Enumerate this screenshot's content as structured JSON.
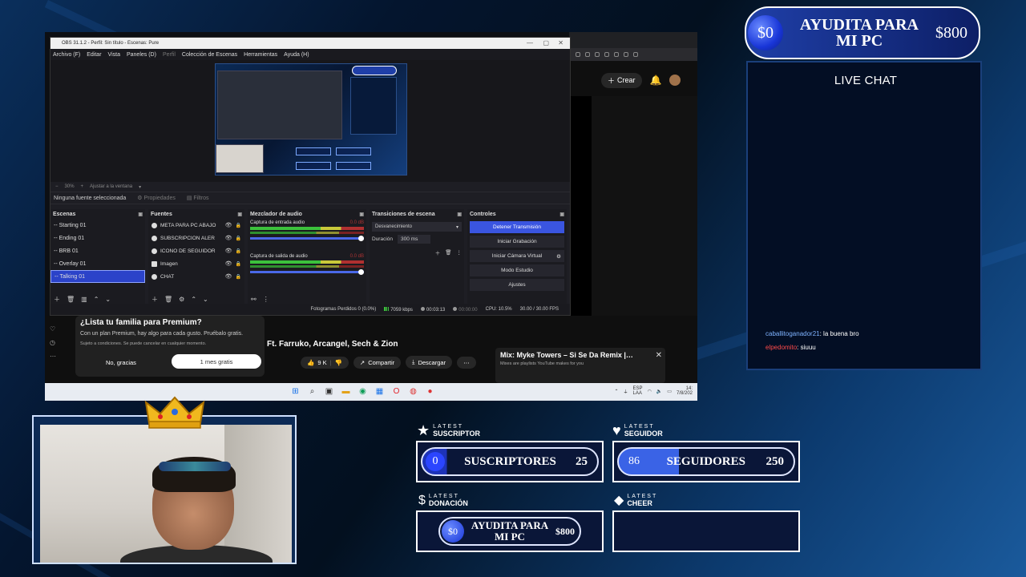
{
  "obs": {
    "window_title": "OBS 31.1.2 - Perfil: Sin título - Escenas: Pure",
    "menu": [
      "Archivo (F)",
      "Editar",
      "Vista",
      "Paneles (D)",
      "Perfil",
      "Colección de Escenas",
      "Herramientas",
      "Ayuda (H)"
    ],
    "zoom": "30%",
    "zoom_mode": "Ajustar a la ventana",
    "no_source": "Ninguna fuente seleccionada",
    "properties": "Propiedades",
    "filters": "Filtros",
    "scenes_title": "Escenas",
    "scenes": [
      "-- Starting 01",
      "-- Ending 01",
      "-- BRB 01",
      "-- Overlay 01",
      "-- Talking 01"
    ],
    "sources_title": "Fuentes",
    "sources": [
      "META PARA PC ABAJO",
      "SUBSCRIPCION ALER",
      "ICONO DE SEGUIDOR",
      "Imagen",
      "CHAT"
    ],
    "mixer_title": "Mezclador de audio",
    "mixer_channels": [
      {
        "name": "Captura de entrada audio",
        "db": "0.0 dB"
      },
      {
        "name": "Captura de salida de audio",
        "db": "0.0 dB"
      }
    ],
    "transitions_title": "Transiciones de escena",
    "transition": "Desvanecimiento",
    "duration_label": "Duración",
    "duration": "300 ms",
    "controls_title": "Controles",
    "controls": [
      "Detener Transmisión",
      "Iniciar Grabación",
      "Iniciar Cámara Virtual",
      "Modo Estudio",
      "Ajustes"
    ],
    "status": {
      "dropped": "Fotogramas Perdidos 0 (0.0%)",
      "bitrate": "7059 kbps",
      "live_time": "00:03:13",
      "rec_time": "00:00:00",
      "cpu": "CPU: 10.5%",
      "fps": "30.00 / 30.00 FPS"
    }
  },
  "youtube": {
    "create": "Crear",
    "promo_title": "¿Lista tu familia para Premium?",
    "promo_text": "Con un plan Premium, hay algo para cada gusto. Pruébalo gratis.",
    "promo_legal": "Sujeto a condiciones. Se puede cancelar en cualquier momento.",
    "promo_no": "No, gracias",
    "promo_yes": "1 mes gratis",
    "video_title": "Ft. Farruko, Arcangel, Sech & Zion",
    "likes": "9 K",
    "share": "Compartir",
    "download": "Descargar",
    "mix_title": "Mix: Myke Towers – Si Se Da Remix |…",
    "mix_sub": "Mixes are playlists YouTube makes for you"
  },
  "taskbar": {
    "lang": "ESP",
    "region": "LAA",
    "time": "14:",
    "date": "7/8/202"
  },
  "goal_top": {
    "current": "$0",
    "label": "AYUDITA PARA MI PC",
    "max": "$800"
  },
  "chat": {
    "title": "LIVE CHAT",
    "messages": [
      {
        "user": "caballitoganador21",
        "text": ": la buena bro",
        "color": "#7fb3ff"
      },
      {
        "user": "elpedomito",
        "text": ": siuuu",
        "color": "#ff4a4a"
      }
    ]
  },
  "alerts": {
    "subscriber": {
      "small": "LATEST",
      "big": "SUSCRIPTOR",
      "current": "0",
      "label": "SUSCRIPTORES",
      "goal": "25"
    },
    "follower": {
      "small": "LATEST",
      "big": "SEGUIDOR",
      "current": "86",
      "label": "SEGUIDORES",
      "goal": "250",
      "progress": 0.344
    },
    "donation": {
      "small": "LATEST",
      "big": "DONACIÓN",
      "current": "$0",
      "label": "AYUDITA PARA MI PC",
      "goal": "$800"
    },
    "cheer": {
      "small": "LATEST",
      "big": "CHEER"
    }
  },
  "colors": {
    "accent": "#2b4bff",
    "obs_primary": "#3a55e0",
    "panel_border": "#1a3f7a"
  }
}
